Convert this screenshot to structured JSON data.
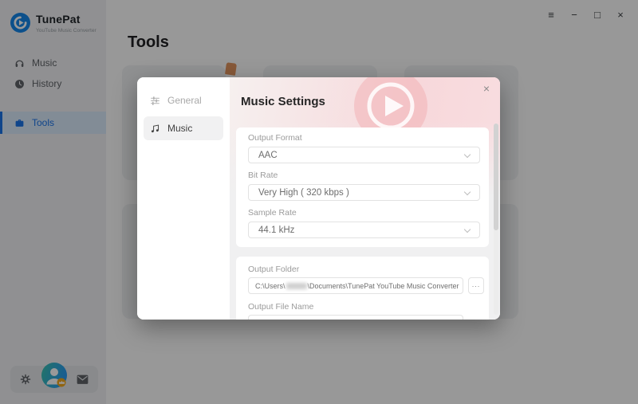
{
  "window": {
    "menu_icon": "≡",
    "minimize_icon": "−",
    "maximize_icon": "□",
    "close_icon": "×"
  },
  "sidebar": {
    "brand": {
      "name": "TunePat",
      "subtitle": "YouTube Music Converter"
    },
    "items": [
      {
        "label": "Music",
        "icon": "headphones-icon",
        "active": false
      },
      {
        "label": "History",
        "icon": "history-clock-icon",
        "active": false
      },
      {
        "label": "Tools",
        "icon": "toolbox-icon",
        "active": true
      }
    ],
    "footer": {
      "icons": [
        "settings-gear-icon",
        "user-avatar",
        "mail-icon"
      ]
    }
  },
  "main": {
    "title": "Tools"
  },
  "dialog": {
    "title": "Music Settings",
    "close_icon": "×",
    "tabs": [
      {
        "label": "General",
        "icon": "sliders-icon",
        "active": false
      },
      {
        "label": "Music",
        "icon": "music-note-icon",
        "active": true
      }
    ],
    "fields": {
      "output_format": {
        "label": "Output Format",
        "value": "AAC"
      },
      "bit_rate": {
        "label": "Bit Rate",
        "value": "Very High ( 320 kbps )"
      },
      "sample_rate": {
        "label": "Sample Rate",
        "value": "44.1 kHz"
      },
      "output_folder": {
        "label": "Output Folder",
        "value_prefix": "C:\\Users\\",
        "value_redacted": true,
        "value_suffix": "\\Documents\\TunePat YouTube Music Converter",
        "browse_label": "..."
      },
      "output_file_name": {
        "label": "Output File Name",
        "value": ""
      }
    }
  },
  "colors": {
    "accent_blue": "#1a73e8",
    "sidebar_active_bg": "#d9e9fb",
    "dialog_header_pink": "#f7d8db",
    "brand_logo_blue": "#1486e8",
    "avatar_badge_gold": "#f0a71d"
  }
}
